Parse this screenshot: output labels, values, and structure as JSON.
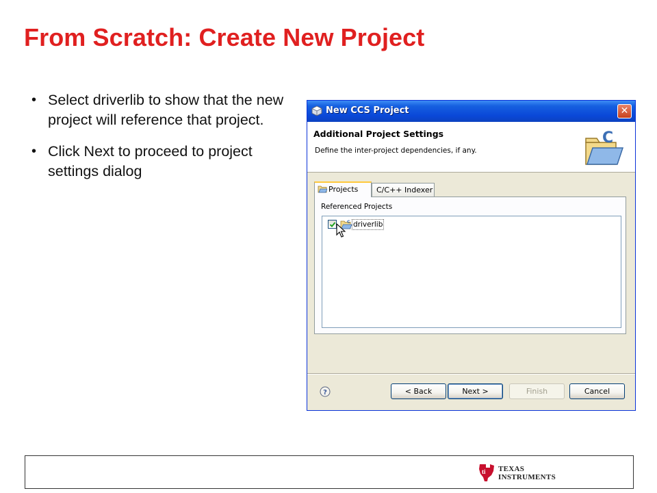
{
  "slide": {
    "title": "From Scratch: Create New Project",
    "bullets": [
      "Select driverlib to show that the new project will reference that project.",
      "Click Next to proceed to project settings dialog"
    ]
  },
  "dialog": {
    "window_title": "New CCS Project",
    "header_title": "Additional Project Settings",
    "header_description": "Define the inter-project dependencies, if any.",
    "tabs": [
      {
        "label": "Projects",
        "active": true
      },
      {
        "label": "C/C++ Indexer",
        "active": false
      }
    ],
    "referenced_projects_label": "Referenced Projects",
    "projects": [
      {
        "name": "driverlib",
        "checked": true
      }
    ],
    "buttons": {
      "back": "< Back",
      "next": "Next >",
      "finish": "Finish",
      "cancel": "Cancel"
    },
    "icons": {
      "window": "gear-cube-icon",
      "wizard": "c-project-folder-icon",
      "close": "close-icon",
      "help": "help-icon"
    }
  },
  "footer": {
    "logo_line1": "TEXAS",
    "logo_line2": "INSTRUMENTS"
  },
  "colors": {
    "title_red": "#e02020",
    "titlebar_blue": "#0a48d8",
    "dialog_bg": "#ece9d8"
  }
}
